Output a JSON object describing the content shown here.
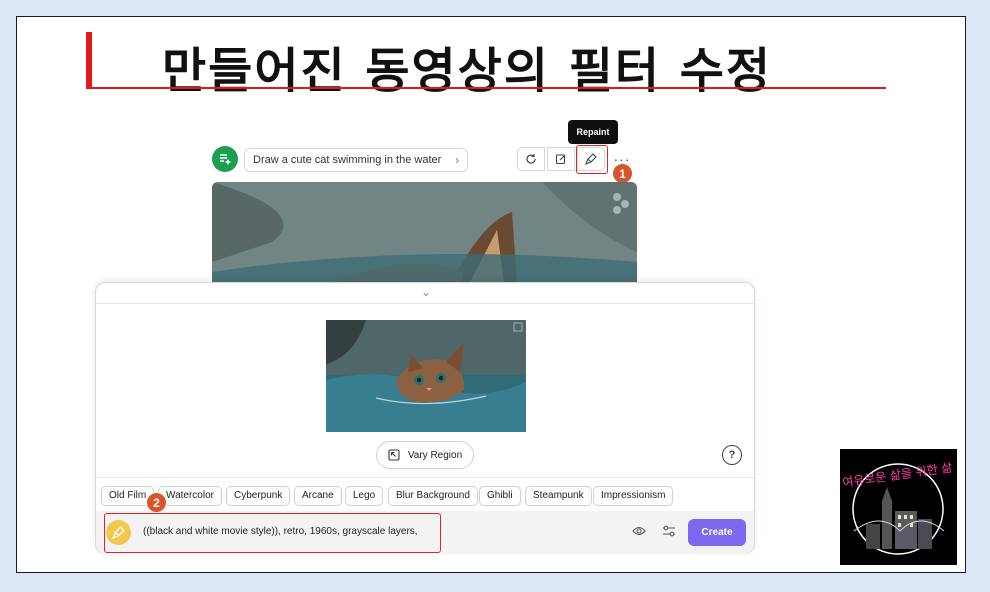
{
  "slide": {
    "title": "만들어진 동영상의 필터 수정"
  },
  "app": {
    "prompt_text": "Draw a cute cat swimming in the water",
    "tooltip": "Repaint",
    "toolbar_icons": [
      "refresh-icon",
      "edit-icon",
      "brush-icon",
      "more-icon"
    ],
    "more_label": "···",
    "step1": "1",
    "step2": "2",
    "vary_region_label": "Vary Region",
    "help_label": "?",
    "filters": [
      "Old Film",
      "Watercolor",
      "Cyberpunk",
      "Arcane",
      "Lego",
      "Blur Background",
      "Ghibli",
      "Steampunk",
      "Impressionism"
    ],
    "input_value": "((black and white movie style)), retro, 1960s, grayscale layers,",
    "create_label": "Create",
    "accent_color": "#7b68ee",
    "highlight_color": "#e02424"
  },
  "logo": {
    "text": "여유로운 삶을 위한 삶"
  }
}
